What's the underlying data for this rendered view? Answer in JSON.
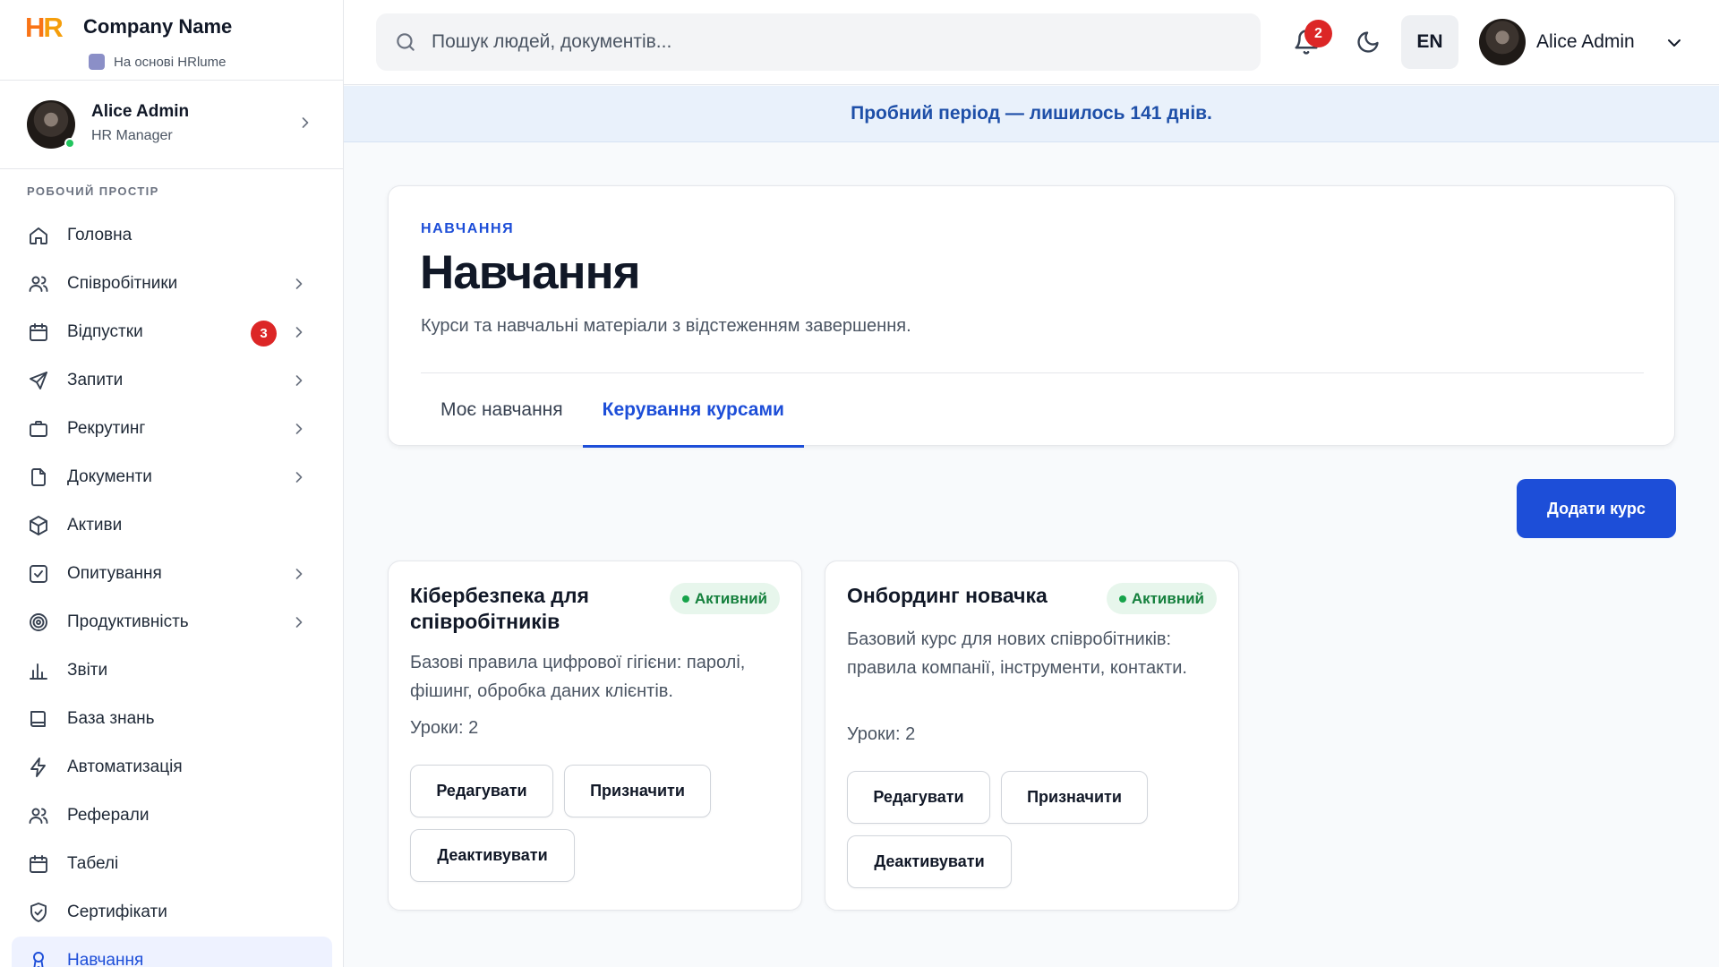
{
  "brand": {
    "logo_text": "HR",
    "company_name": "Company Name",
    "powered_by": "На основі HRlume"
  },
  "sidebar_user": {
    "name": "Alice Admin",
    "role": "HR Manager"
  },
  "sidebar": {
    "section_title": "РОБОЧИЙ ПРОСТІР",
    "items": [
      {
        "label": "Головна",
        "icon": "home-icon",
        "chevron": false
      },
      {
        "label": "Співробітники",
        "icon": "users-icon",
        "chevron": true
      },
      {
        "label": "Відпустки",
        "icon": "calendar-icon",
        "chevron": true,
        "badge": "3"
      },
      {
        "label": "Запити",
        "icon": "send-icon",
        "chevron": true
      },
      {
        "label": "Рекрутинг",
        "icon": "briefcase-icon",
        "chevron": true
      },
      {
        "label": "Документи",
        "icon": "file-icon",
        "chevron": true
      },
      {
        "label": "Активи",
        "icon": "box-icon",
        "chevron": false
      },
      {
        "label": "Опитування",
        "icon": "checkbox-icon",
        "chevron": true
      },
      {
        "label": "Продуктивність",
        "icon": "target-icon",
        "chevron": true
      },
      {
        "label": "Звіти",
        "icon": "bar-chart-icon",
        "chevron": false
      },
      {
        "label": "База знань",
        "icon": "book-icon",
        "chevron": false
      },
      {
        "label": "Автоматизація",
        "icon": "bolt-icon",
        "chevron": false
      },
      {
        "label": "Реферали",
        "icon": "users-icon",
        "chevron": false
      },
      {
        "label": "Табелі",
        "icon": "calendar-icon",
        "chevron": false
      },
      {
        "label": "Сертифікати",
        "icon": "shield-check-icon",
        "chevron": false
      },
      {
        "label": "Навчання",
        "icon": "award-icon",
        "chevron": false,
        "active": true
      }
    ]
  },
  "topbar": {
    "search_placeholder": "Пошук людей, документів...",
    "notifications_count": "2",
    "language": "EN",
    "user_name": "Alice Admin"
  },
  "trial_banner": "Пробний період — лишилось 141 днів.",
  "header": {
    "eyebrow": "НАВЧАННЯ",
    "title": "Навчання",
    "description": "Курси та навчальні матеріали з відстеженням завершення.",
    "tabs": [
      {
        "label": "Моє навчання",
        "active": false
      },
      {
        "label": "Керування курсами",
        "active": true
      }
    ]
  },
  "actions": {
    "add_course": "Додати курс"
  },
  "courses": [
    {
      "title": "Кібербезпека для співробітників",
      "status": "Активний",
      "description": "Базові правила цифрової гігієни: паролі, фішинг, обробка даних клієнтів.",
      "lessons": "Уроки: 2",
      "edit": "Редагувати",
      "assign": "Призначити",
      "deactivate": "Деактивувати"
    },
    {
      "title": "Онбординг новачка",
      "status": "Активний",
      "description": "Базовий курс для нових співробітників: правила компанії, інструменти, контакти.",
      "lessons": "Уроки: 2",
      "edit": "Редагувати",
      "assign": "Призначити",
      "deactivate": "Деактивувати"
    }
  ],
  "colors": {
    "accent": "#1d4ed8",
    "danger": "#dc2626",
    "success": "#15803d",
    "banner_bg": "#e9f1fb"
  }
}
